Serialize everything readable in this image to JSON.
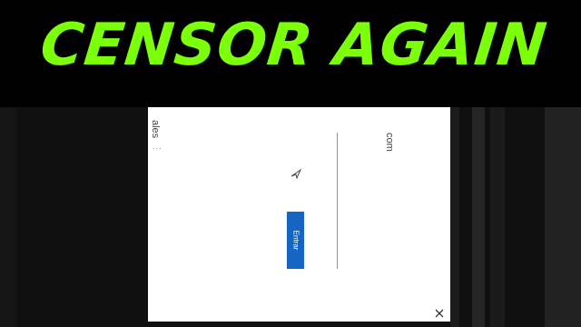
{
  "thumbnail": {
    "headline": "CENSOR AGAIN"
  },
  "dialog": {
    "left_fragment": "ales",
    "dots": "...",
    "right_fragment": "com",
    "enter_label": "Entrar"
  },
  "icons": {
    "close": "close-icon",
    "arrow": "arrow-icon"
  },
  "colors": {
    "headline": "#7CFF0A",
    "button": "#1566c2",
    "background": "#000000"
  }
}
